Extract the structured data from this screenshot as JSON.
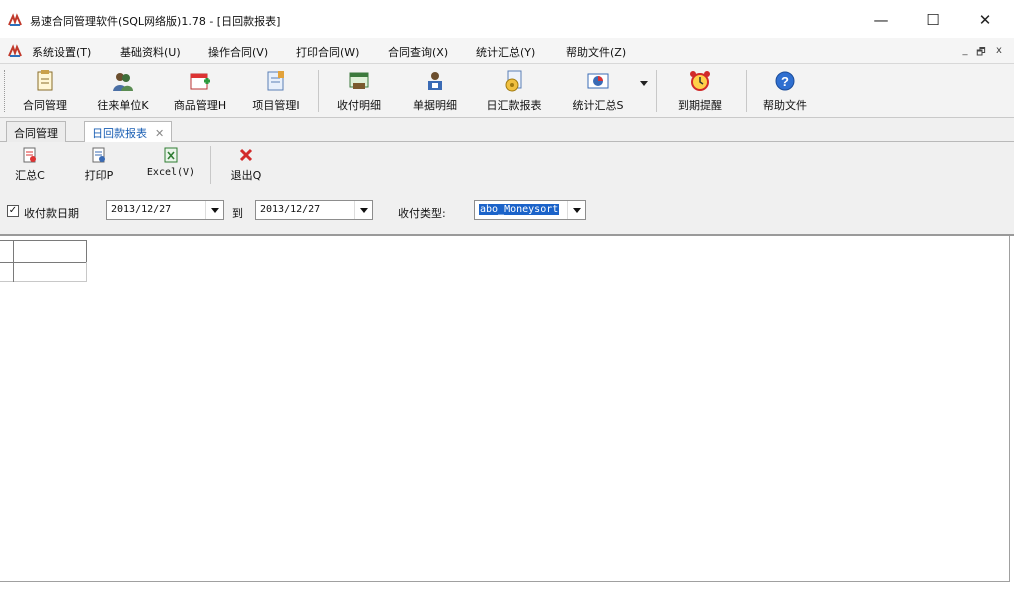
{
  "window": {
    "title": "易速合同管理软件(SQL网络版)1.78 - [日回款报表]",
    "app_icon": "app-logo-icon",
    "controls": {
      "minimize": "—",
      "maximize": "☐",
      "close": "✕"
    }
  },
  "menubar": {
    "items": [
      "系统设置(T)",
      "基础资料(U)",
      "操作合同(V)",
      "打印合同(W)",
      "合同查询(X)",
      "统计汇总(Y)",
      "帮助文件(Z)"
    ],
    "mdi_controls": {
      "minimize": "_",
      "restore": "🗗",
      "close": "x"
    }
  },
  "toolbar": {
    "buttons": [
      {
        "label": "合同管理",
        "icon": "contract-icon"
      },
      {
        "label": "往来单位K",
        "icon": "people-icon"
      },
      {
        "label": "商品管理H",
        "icon": "goods-icon"
      },
      {
        "label": "项目管理I",
        "icon": "project-icon"
      },
      {
        "label": "收付明细",
        "icon": "payment-detail-icon"
      },
      {
        "label": "单据明细",
        "icon": "document-detail-icon"
      },
      {
        "label": "日汇款报表",
        "icon": "daily-report-icon"
      },
      {
        "label": "统计汇总S",
        "icon": "statistics-icon"
      },
      {
        "label": "到期提醒",
        "icon": "alarm-clock-icon"
      },
      {
        "label": "帮助文件",
        "icon": "help-icon"
      }
    ]
  },
  "tabs": [
    {
      "label": "合同管理",
      "active": false
    },
    {
      "label": "日回款报表",
      "active": true,
      "close": "✕"
    }
  ],
  "subtoolbar": {
    "buttons": [
      {
        "label": "汇总C",
        "icon": "summary-icon"
      },
      {
        "label": "打印P",
        "icon": "print-icon"
      },
      {
        "label": "Excel(V)",
        "icon": "excel-icon"
      },
      {
        "label": "退出Q",
        "icon": "exit-icon"
      }
    ]
  },
  "filters": {
    "date_checkbox_checked": true,
    "date_label": "收付款日期",
    "date_from": "2013/12/27",
    "to_label": "到",
    "date_to": "2013/12/27",
    "type_label": "收付类型:",
    "type_value": "abo_Moneysort"
  },
  "colors": {
    "accent": "#1b63c9",
    "tab_active_text": "#1a5fb4",
    "exit_red": "#d22a2a"
  }
}
